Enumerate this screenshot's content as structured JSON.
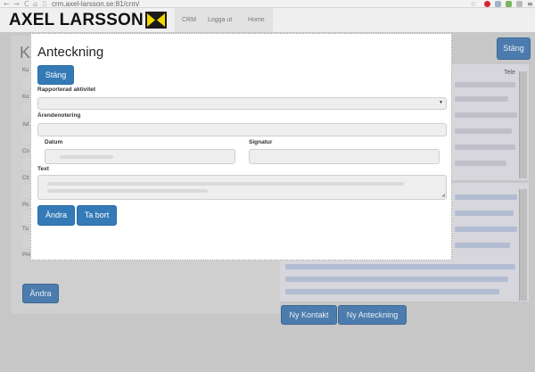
{
  "browser": {
    "back_glyph": "←",
    "forward_glyph": "→",
    "reload_glyph": "C",
    "home_glyph": "⌂",
    "url": "crm.axel-larsson.se:81/crm/",
    "star_glyph": "☆"
  },
  "header": {
    "logo_text": "AXEL LARSSON",
    "nav": [
      {
        "label": "CRM"
      },
      {
        "label": "Logga ut"
      },
      {
        "label": "Home"
      }
    ]
  },
  "background": {
    "title_initial": "K",
    "stang_label": "Stäng",
    "andra_label": "Ändra",
    "ny_kontakt_label": "Ny Kontakt",
    "ny_anteckning_label": "Ny Anteckning",
    "tele_label": "Tele",
    "field_labels": [
      "Ku",
      "Ko",
      "Ad",
      "Co",
      "Cit",
      "Po",
      "Tu",
      "Pre"
    ]
  },
  "modal": {
    "title": "Anteckning",
    "close_label": "Stäng",
    "reported_activity_label": "Rapporterad aktivitet",
    "case_note_label": "Ärendenotering",
    "date_label": "Datum",
    "signature_label": "Signatur",
    "text_label": "Text",
    "change_label": "Ändra",
    "delete_label": "Ta bort"
  },
  "colors": {
    "primary_button": "#337ab7",
    "overlay_bg": "#c7c7c7"
  }
}
